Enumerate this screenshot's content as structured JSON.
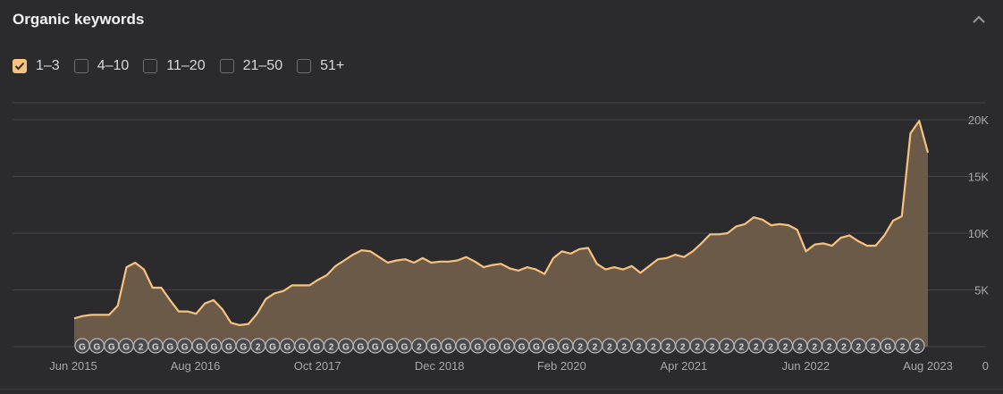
{
  "header": {
    "title": "Organic keywords"
  },
  "filters": [
    {
      "label": "1–3",
      "checked": true
    },
    {
      "label": "4–10",
      "checked": false
    },
    {
      "label": "11–20",
      "checked": false
    },
    {
      "label": "21–50",
      "checked": false
    },
    {
      "label": "51+",
      "checked": false
    }
  ],
  "colors": {
    "accent": "#f7c27f",
    "area_fill": "#6f5d4a",
    "grid": "#45454a",
    "background": "#2b2b2d",
    "marker": "#4a4a4e"
  },
  "icons": {
    "collapse": "chevron-up-icon",
    "checkbox": "check-icon"
  },
  "chart_data": {
    "type": "area",
    "x_labels": [
      "Jun 2015",
      "Aug 2016",
      "Oct 2017",
      "Dec 2018",
      "Feb 2020",
      "Apr 2021",
      "Jun 2022",
      "Aug 2023"
    ],
    "y_ticks": [
      "0",
      "5K",
      "10K",
      "15K",
      "20K"
    ],
    "ylim": [
      0,
      20000
    ],
    "grid": true,
    "series": [
      {
        "values": [
          2500,
          2700,
          2800,
          2800,
          2800,
          3600,
          7000,
          7400,
          6800,
          5200,
          5200,
          4100,
          3100,
          3100,
          2900,
          3800,
          4100,
          3300,
          2100,
          1900,
          2000,
          2900,
          4200,
          4700,
          4900,
          5400,
          5400,
          5400,
          5900,
          6300,
          7100,
          7600,
          8100,
          8500,
          8400,
          7900,
          7400,
          7600,
          7700,
          7400,
          7800,
          7400,
          7500,
          7500,
          7600,
          7900,
          7500,
          7000,
          7200,
          7300,
          6900,
          6700,
          7000,
          6800,
          6400,
          7800,
          8400,
          8200,
          8600,
          8700,
          7300,
          6800,
          7000,
          6800,
          7100,
          6500,
          7100,
          7700,
          7800,
          8100,
          7900,
          8400,
          9100,
          9900,
          9900,
          10000,
          10600,
          10800,
          11400,
          11200,
          10700,
          10800,
          10700,
          10300,
          8400,
          9000,
          9100,
          8900,
          9600,
          9800,
          9300,
          8900,
          8900,
          9800,
          11100,
          11500,
          18800,
          19900,
          17100
        ]
      }
    ],
    "event_markers": [
      "G",
      "G",
      "G",
      "G",
      "2",
      "G",
      "G",
      "G",
      "G",
      "G",
      "G",
      "G",
      "2",
      "G",
      "G",
      "G",
      "G",
      "2",
      "G",
      "G",
      "G",
      "G",
      "G",
      "2",
      "G",
      "G",
      "G",
      "G",
      "G",
      "G",
      "G",
      "G",
      "G",
      "G",
      "2",
      "2",
      "2",
      "2",
      "2",
      "2",
      "2",
      "2",
      "2",
      "2",
      "2",
      "2",
      "2",
      "2",
      "2",
      "2",
      "2",
      "2",
      "2",
      "2",
      "2",
      "G",
      "2",
      "2"
    ]
  }
}
